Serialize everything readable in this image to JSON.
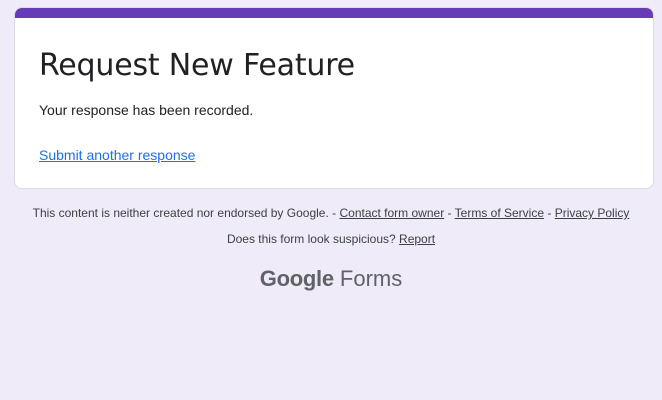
{
  "theme": {
    "accent_color": "#673ab7",
    "link_color": "#1a73e8",
    "background_color": "#f0ebf8"
  },
  "card": {
    "title": "Request New Feature",
    "confirmation_message": "Your response has been recorded.",
    "submit_another_link": "Submit another response"
  },
  "footer": {
    "disclaimer": "This content is neither created nor endorsed by Google.",
    "separator": " - ",
    "contact_owner_link": "Contact form owner",
    "terms_link": "Terms of Service",
    "privacy_link": "Privacy Policy",
    "suspicious_question": "Does this form look suspicious?",
    "report_link": "Report"
  },
  "brand": {
    "google_word": "Google",
    "forms_word": "Forms"
  }
}
